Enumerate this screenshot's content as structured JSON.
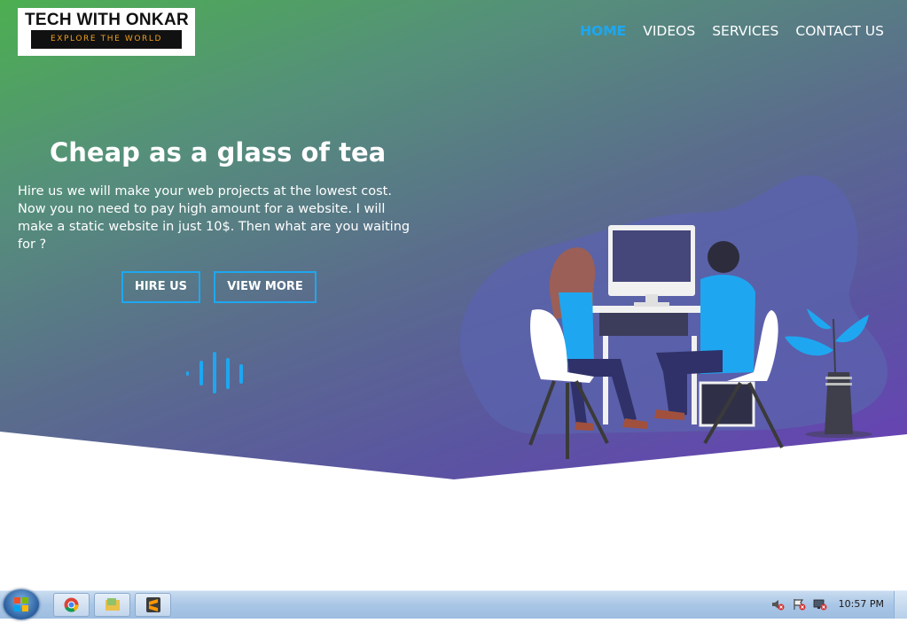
{
  "logo": {
    "title": "TECH WITH ONKAR",
    "tagline": "EXPLORE THE WORLD"
  },
  "nav": {
    "items": [
      {
        "label": "HOME",
        "active": true
      },
      {
        "label": "VIDEOS",
        "active": false
      },
      {
        "label": "SERVICES",
        "active": false
      },
      {
        "label": "CONTACT US",
        "active": false
      }
    ]
  },
  "hero": {
    "headline": "Cheap as a glass of tea",
    "description": "Hire us we will make your web projects at the lowest cost. Now you no need to pay high amount for a website. I will make a static website in just 10$. Then what are you waiting for ?",
    "hire_button": "HIRE US",
    "view_more_button": "VIEW MORE"
  },
  "taskbar": {
    "apps": [
      {
        "icon": "chrome-icon"
      },
      {
        "icon": "file-explorer-icon"
      },
      {
        "icon": "sublime-text-icon"
      }
    ],
    "clock": "10:57 PM"
  },
  "colors": {
    "accent": "#1ea7f0",
    "gradient_start": "#4caf50",
    "gradient_end": "#6a3fb8"
  }
}
